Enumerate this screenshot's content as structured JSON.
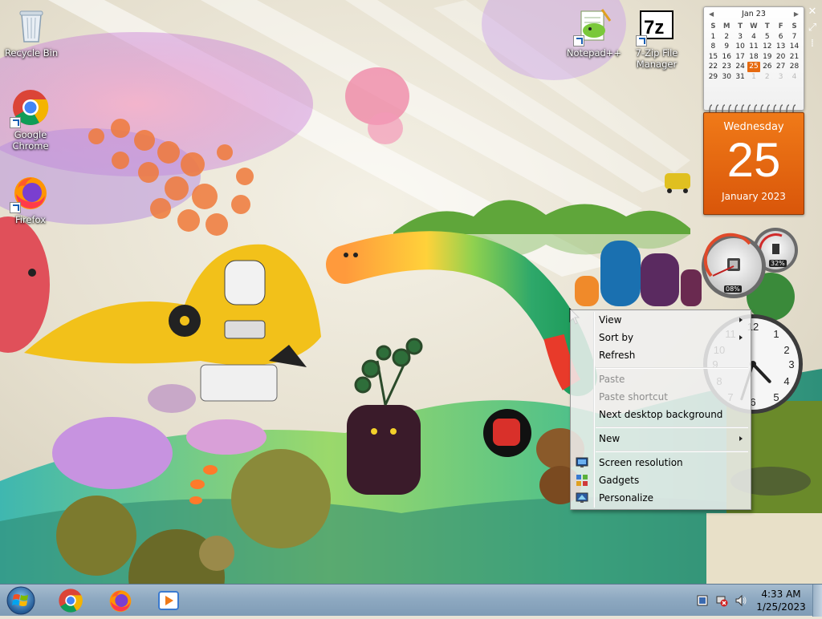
{
  "desktop": {
    "icons": [
      {
        "label": "Recycle Bin",
        "icon": "recycle-bin-icon"
      },
      {
        "label": "Google Chrome",
        "icon": "chrome-icon"
      },
      {
        "label": "Firefox",
        "icon": "firefox-icon"
      },
      {
        "label": "Notepad++",
        "icon": "notepadpp-icon"
      },
      {
        "label": "7-Zip File Manager",
        "icon": "7zip-icon"
      }
    ]
  },
  "calendar_gadget": {
    "month_label": "Jan 23",
    "weekdays": [
      "S",
      "M",
      "T",
      "W",
      "T",
      "F",
      "S"
    ],
    "weeks": [
      [
        "1",
        "2",
        "3",
        "4",
        "5",
        "6",
        "7"
      ],
      [
        "8",
        "9",
        "10",
        "11",
        "12",
        "13",
        "14"
      ],
      [
        "15",
        "16",
        "17",
        "18",
        "19",
        "20",
        "21"
      ],
      [
        "22",
        "23",
        "24",
        "25",
        "26",
        "27",
        "28"
      ],
      [
        "29",
        "30",
        "31",
        "1",
        "2",
        "3",
        "4"
      ]
    ],
    "today": "25",
    "weekday_name": "Wednesday",
    "day_number": "25",
    "month_year": "January 2023"
  },
  "cpu_gadget": {
    "cpu_percent": "08%",
    "memory_percent": "32%"
  },
  "clock_gadget": {
    "hour": 4,
    "minute": 33
  },
  "context_menu": {
    "items": [
      {
        "label": "View",
        "submenu": true,
        "disabled": false
      },
      {
        "label": "Sort by",
        "submenu": true,
        "disabled": false
      },
      {
        "label": "Refresh",
        "submenu": false,
        "disabled": false
      },
      {
        "label": "Paste",
        "submenu": false,
        "disabled": true
      },
      {
        "label": "Paste shortcut",
        "submenu": false,
        "disabled": true
      },
      {
        "label": "Next desktop background",
        "submenu": false,
        "disabled": false
      },
      {
        "label": "New",
        "submenu": true,
        "disabled": false
      },
      {
        "label": "Screen resolution",
        "submenu": false,
        "disabled": false,
        "icon": "screen-resolution-icon"
      },
      {
        "label": "Gadgets",
        "submenu": false,
        "disabled": false,
        "icon": "gadgets-icon"
      },
      {
        "label": "Personalize",
        "submenu": false,
        "disabled": false,
        "icon": "personalize-icon"
      }
    ]
  },
  "taskbar": {
    "pinned": [
      "chrome-icon",
      "firefox-icon",
      "media-player-icon"
    ],
    "tray_icons": [
      "action-center-icon",
      "network-icon",
      "volume-icon"
    ],
    "time": "4:33 AM",
    "date": "1/25/2023"
  },
  "colors": {
    "calendar_accent": "#e66a10",
    "taskbar": "#8ea9c1"
  }
}
